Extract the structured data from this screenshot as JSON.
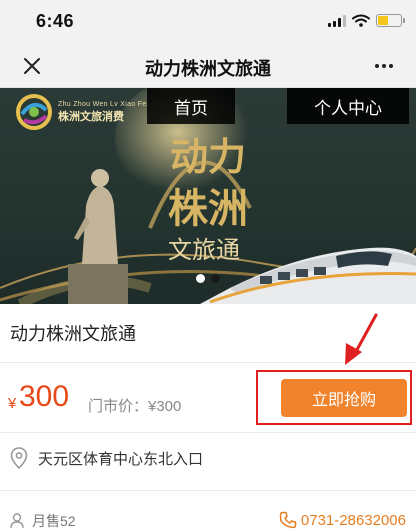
{
  "status_bar": {
    "time": "6:46"
  },
  "nav": {
    "title": "动力株洲文旅通",
    "close_icon": "close-icon",
    "more_icon": "more-icon"
  },
  "banner": {
    "logo_small": "Zhu Zhou Wen Lv Xiao Fei",
    "logo_main": "株洲文旅消费",
    "tab_home": "首页",
    "tab_profile": "个人中心",
    "calligraphy": [
      "动力",
      "株洲",
      "文旅通"
    ],
    "active_slide": 1,
    "slide_count": 2
  },
  "product": {
    "title": "动力株洲文旅通",
    "currency": "¥",
    "price": "300",
    "market_price": "门市价：¥300",
    "buy_label": "立即抢购",
    "address": "天元区体育中心东北入口",
    "sold": "月售52",
    "phone": "0731-28632006"
  },
  "colors": {
    "accent_price": "#e64a19",
    "buy_button": "#f0832c",
    "highlight_frame": "#e02020",
    "phone": "#e67e22"
  }
}
